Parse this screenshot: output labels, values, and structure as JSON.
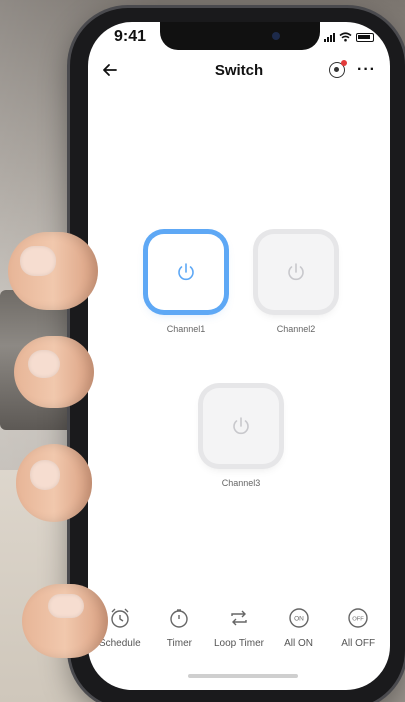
{
  "status": {
    "time": "9:41"
  },
  "header": {
    "back_icon": "arrow-left-icon",
    "title": "Switch",
    "camera_icon": "camera-icon",
    "more_icon": "more-icon"
  },
  "channels": [
    {
      "label": "Channel1",
      "state": "on"
    },
    {
      "label": "Channel2",
      "state": "off"
    },
    {
      "label": "Channel3",
      "state": "off"
    }
  ],
  "bottom_bar": [
    {
      "label": "Schedule",
      "icon": "clock-icon"
    },
    {
      "label": "Timer",
      "icon": "timer-icon"
    },
    {
      "label": "Loop Timer",
      "icon": "loop-icon"
    },
    {
      "label": "All ON",
      "icon": "on-icon",
      "icon_text": "ON"
    },
    {
      "label": "All OFF",
      "icon": "off-icon",
      "icon_text": "OFF"
    }
  ],
  "colors": {
    "accent": "#5ea8f5",
    "inactive": "#e6e6e8"
  }
}
